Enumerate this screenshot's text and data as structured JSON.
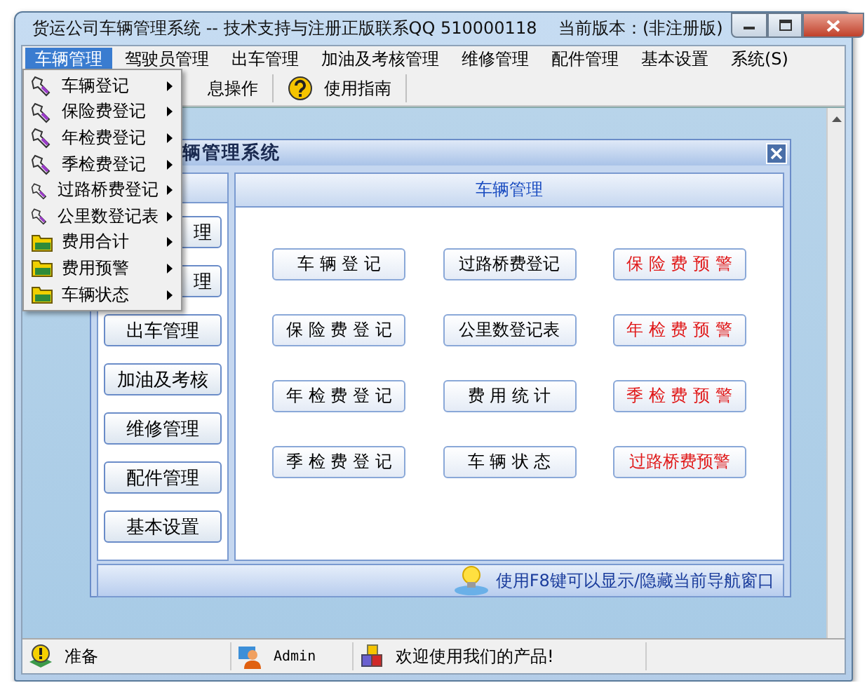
{
  "window": {
    "title": "货运公司车辆管理系统 -- 技术支持与注册正版联系QQ 510000118    当前版本：(非注册版)"
  },
  "menubar": [
    {
      "label": "车辆管理",
      "selected": true
    },
    {
      "label": "驾驶员管理",
      "selected": false
    },
    {
      "label": "出车管理",
      "selected": false
    },
    {
      "label": "加油及考核管理",
      "selected": false
    },
    {
      "label": "维修管理",
      "selected": false
    },
    {
      "label": "配件管理",
      "selected": false
    },
    {
      "label": "基本设置",
      "selected": false
    },
    {
      "label": "系统(S)",
      "selected": false
    }
  ],
  "toolbar": [
    {
      "label": "息操作",
      "kind": "plain"
    },
    {
      "label": "使用指南",
      "kind": "help"
    }
  ],
  "dropdown": [
    {
      "label": "车辆登记",
      "kind": "tool"
    },
    {
      "label": "保险费登记",
      "kind": "tool"
    },
    {
      "label": "年检费登记",
      "kind": "tool"
    },
    {
      "label": "季检费登记",
      "kind": "tool"
    },
    {
      "label": "过路桥费登记",
      "kind": "tool"
    },
    {
      "label": "公里数登记表",
      "kind": "tool"
    },
    {
      "label": "费用合计",
      "kind": "folder"
    },
    {
      "label": "费用预警",
      "kind": "folder"
    },
    {
      "label": "车辆状态",
      "kind": "folder"
    }
  ],
  "child_window": {
    "title": "辆管理系统",
    "nav_buttons": [
      {
        "label": "理",
        "kind": "covered"
      },
      {
        "label": "理",
        "kind": "covered"
      },
      {
        "label": "出车管理",
        "kind": "nav"
      },
      {
        "label": "加油及考核",
        "kind": "nav"
      },
      {
        "label": "维修管理",
        "kind": "nav"
      },
      {
        "label": "配件管理",
        "kind": "nav"
      },
      {
        "label": "基本设置",
        "kind": "nav"
      }
    ],
    "panel_title": "车辆管理",
    "buttons": [
      {
        "label": "车 辆 登 记",
        "kind": "normal"
      },
      {
        "label": "过路桥费登记",
        "kind": "normal"
      },
      {
        "label": "保 险 费 预 警",
        "kind": "warning"
      },
      {
        "label": "保 险 费 登 记",
        "kind": "normal"
      },
      {
        "label": "公里数登记表",
        "kind": "normal"
      },
      {
        "label": "年 检 费 预 警",
        "kind": "warning"
      },
      {
        "label": "年 检 费 登 记",
        "kind": "normal"
      },
      {
        "label": "费 用 统 计",
        "kind": "normal"
      },
      {
        "label": "季 检 费 预 警",
        "kind": "warning"
      },
      {
        "label": "季 检 费 登 记",
        "kind": "normal"
      },
      {
        "label": "车 辆 状 态",
        "kind": "normal"
      },
      {
        "label": "过路桥费预警",
        "kind": "warning"
      }
    ],
    "hint": "使用F8键可以显示/隐藏当前导航窗口"
  },
  "status_bar": [
    {
      "text": "准备",
      "kind": "ready"
    },
    {
      "text": "Admin",
      "kind": "user"
    },
    {
      "text": "欢迎使用我们的产品!",
      "kind": "info"
    }
  ]
}
